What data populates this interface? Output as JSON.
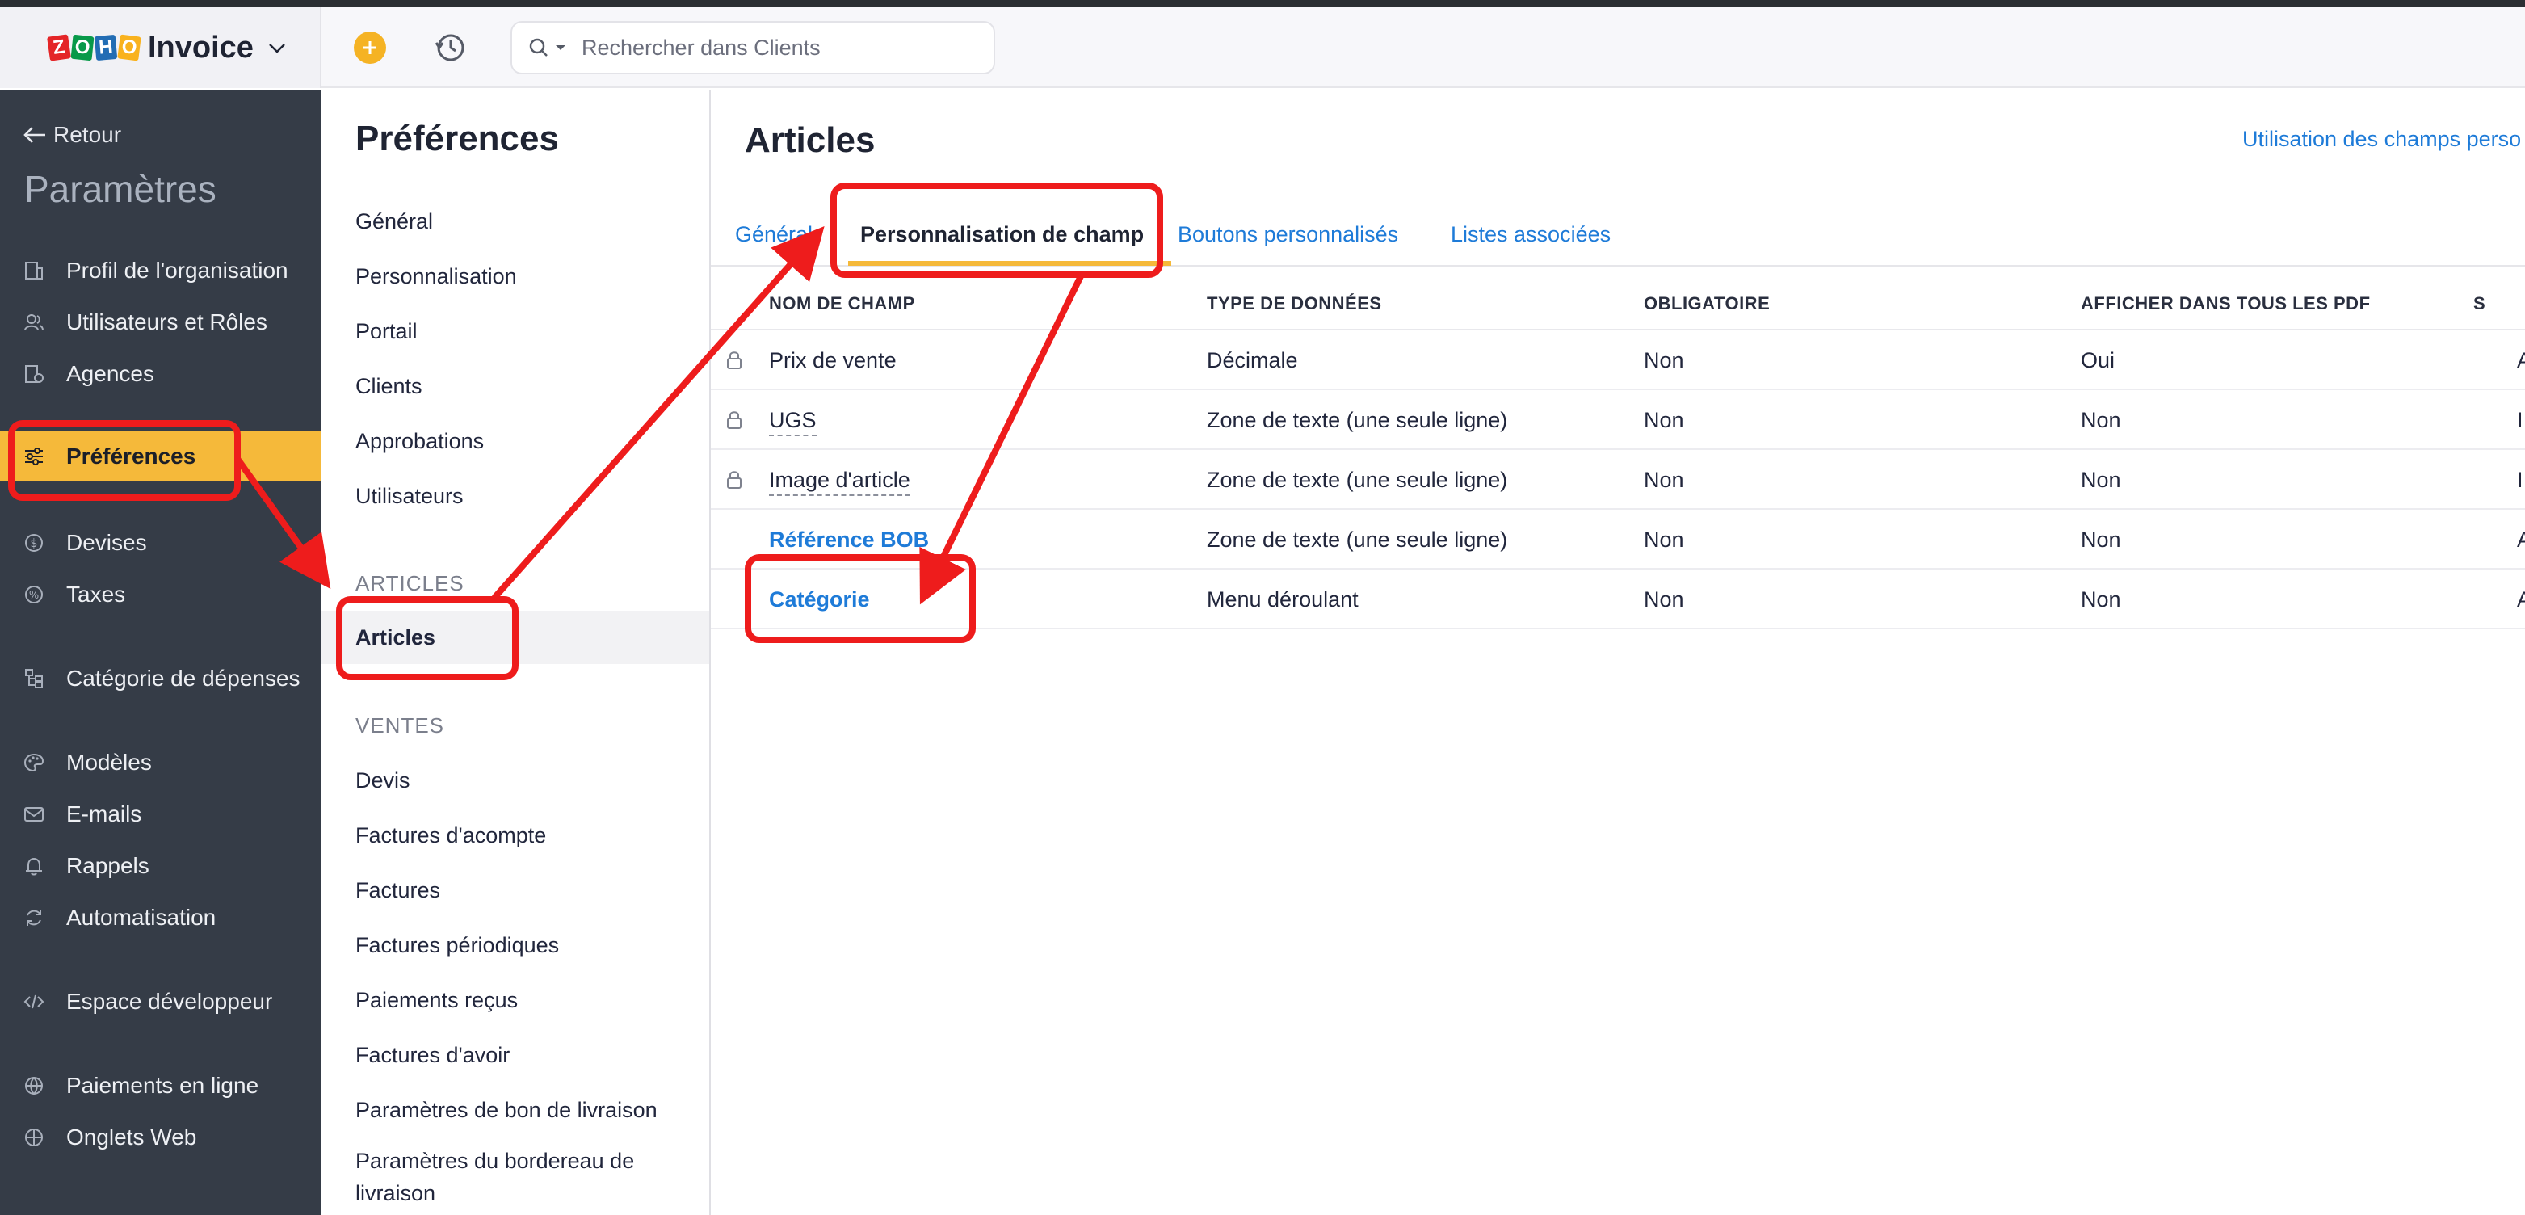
{
  "header": {
    "logo_letters": [
      "Z",
      "O",
      "H",
      "O"
    ],
    "logo_colors": [
      "#e42527",
      "#089949",
      "#226db4",
      "#f9b21d"
    ],
    "app_name": "Invoice",
    "search_placeholder": "Rechercher dans Clients"
  },
  "sidebar": {
    "back_label": "Retour",
    "title": "Paramètres",
    "items": [
      {
        "label": "Profil de l'organisation",
        "icon": "building-icon"
      },
      {
        "label": "Utilisateurs et Rôles",
        "icon": "users-icon"
      },
      {
        "label": "Agences",
        "icon": "branch-icon"
      },
      {
        "label": "Préférences",
        "icon": "sliders-icon",
        "active": true
      },
      {
        "label": "Devises",
        "icon": "currency-icon"
      },
      {
        "label": "Taxes",
        "icon": "percent-icon"
      },
      {
        "label": "Catégorie de dépenses",
        "icon": "hierarchy-icon"
      },
      {
        "label": "Modèles",
        "icon": "palette-icon"
      },
      {
        "label": "E-mails",
        "icon": "mail-icon"
      },
      {
        "label": "Rappels",
        "icon": "bell-icon"
      },
      {
        "label": "Automatisation",
        "icon": "refresh-icon"
      },
      {
        "label": "Espace développeur",
        "icon": "code-icon"
      },
      {
        "label": "Paiements en ligne",
        "icon": "globe-icon"
      },
      {
        "label": "Onglets Web",
        "icon": "web-tab-icon"
      }
    ]
  },
  "preferences": {
    "title": "Préférences",
    "general_items": [
      "Général",
      "Personnalisation",
      "Portail",
      "Clients",
      "Approbations",
      "Utilisateurs"
    ],
    "articles_section": "ARTICLES",
    "articles_item": "Articles",
    "ventes_section": "VENTES",
    "ventes_items": [
      "Devis",
      "Factures d'acompte",
      "Factures",
      "Factures périodiques",
      "Paiements reçus",
      "Factures d'avoir",
      "Paramètres de bon de livraison"
    ],
    "last_item_line1": "Paramètres du bordereau de",
    "last_item_line2": "livraison"
  },
  "main": {
    "title": "Articles",
    "top_link": "Utilisation des champs perso",
    "tabs": [
      "Général",
      "Personnalisation de champ",
      "Boutons personnalisés",
      "Listes associées"
    ],
    "active_tab": "Personnalisation de champ",
    "columns": [
      "NOM DE CHAMP",
      "TYPE DE DONNÉES",
      "OBLIGATOIRE",
      "AFFICHER DANS TOUS LES PDF",
      "S"
    ],
    "rows": [
      {
        "name": "Prix de vente",
        "type": "Décimale",
        "required": "Non",
        "pdf": "Oui",
        "extra": "A",
        "locked": true,
        "custom": false
      },
      {
        "name": "UGS",
        "type": "Zone de texte (une seule ligne)",
        "required": "Non",
        "pdf": "Non",
        "extra": "I",
        "locked": true,
        "custom": false
      },
      {
        "name": "Image d'article",
        "type": "Zone de texte (une seule ligne)",
        "required": "Non",
        "pdf": "Non",
        "extra": "I",
        "locked": true,
        "custom": false
      },
      {
        "name": "Référence BOB",
        "type": "Zone de texte (une seule ligne)",
        "required": "Non",
        "pdf": "Non",
        "extra": "A",
        "locked": false,
        "custom": true
      },
      {
        "name": "Catégorie",
        "type": "Menu déroulant",
        "required": "Non",
        "pdf": "Non",
        "extra": "A",
        "locked": false,
        "custom": true
      }
    ]
  },
  "colors": {
    "accent": "#f5b93a",
    "link": "#1e7bd8",
    "sidebar_bg": "#353c47",
    "annotation": "#ee1c1c"
  }
}
